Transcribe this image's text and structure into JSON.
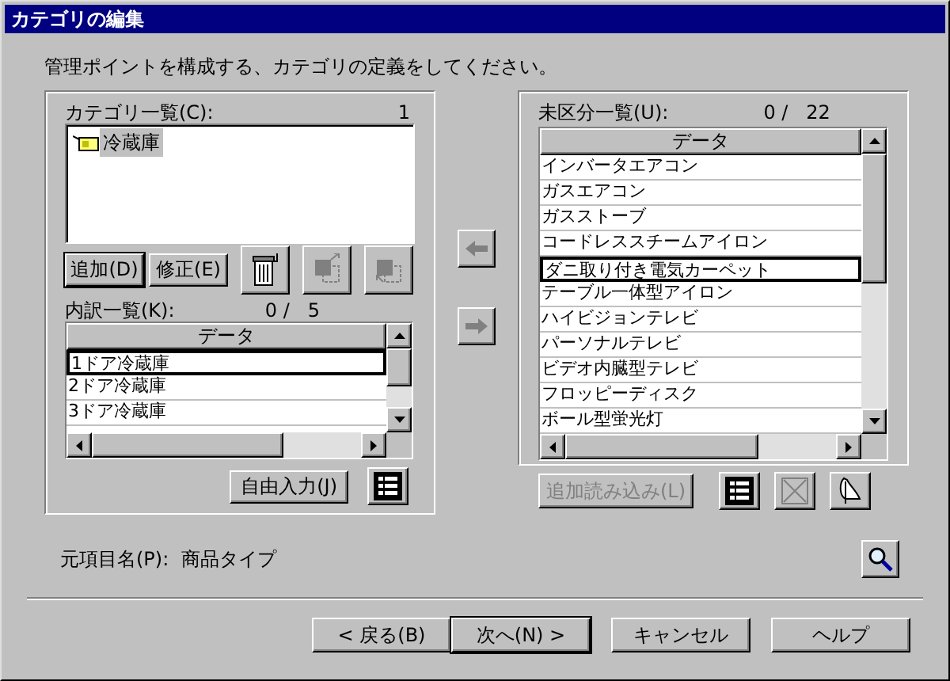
{
  "window": {
    "title": "カテゴリの編集"
  },
  "instruction": "管理ポイントを構成する、カテゴリの定義をしてください。",
  "category_list": {
    "label": "カテゴリ一覧(C):",
    "count": "1",
    "items": [
      {
        "label": "冷蔵庫",
        "selected": true
      }
    ]
  },
  "category_buttons": [
    {
      "label": "追加(D)",
      "disabled": false
    },
    {
      "label": "修正(E)",
      "disabled": false
    }
  ],
  "category_icon_buttons": [
    {
      "disabled": false
    },
    {
      "disabled": true
    },
    {
      "disabled": true
    }
  ],
  "breakdown_list": {
    "label": "内訳一覧(K):",
    "count": "0 /   5",
    "column": "データ",
    "rows": [
      {
        "text": "1ドア冷蔵庫",
        "focused": true
      },
      {
        "text": "2ドア冷蔵庫",
        "focused": false
      },
      {
        "text": "3ドア冷蔵庫",
        "focused": false
      }
    ]
  },
  "breakdown_buttons": {
    "free_input": {
      "label": "自由入力(J)",
      "disabled": false
    },
    "list_button": {
      "disabled": false
    }
  },
  "move_buttons": [
    {
      "disabled": true
    },
    {
      "disabled": true
    }
  ],
  "unclassified_list": {
    "label": "未区分一覧(U):",
    "count": "0 /   22",
    "column": "データ",
    "rows": [
      {
        "text": "インバータエアコン",
        "focused": false
      },
      {
        "text": "ガスエアコン",
        "focused": false
      },
      {
        "text": "ガスストーブ",
        "focused": false
      },
      {
        "text": "コードレススチームアイロン",
        "focused": false
      },
      {
        "text": "ダニ取り付き電気カーペット",
        "focused": true
      },
      {
        "text": "テーブル一体型アイロン",
        "focused": false
      },
      {
        "text": "ハイビジョンテレビ",
        "focused": false
      },
      {
        "text": "パーソナルテレビ",
        "focused": false
      },
      {
        "text": "ビデオ内臓型テレビ",
        "focused": false
      },
      {
        "text": "フロッピーディスク",
        "focused": false
      },
      {
        "text": "ボール型蛍光灯",
        "focused": false
      }
    ]
  },
  "unclassified_buttons": {
    "load_more": {
      "label": "追加読み込み(L)",
      "disabled": true
    },
    "icon_buttons": [
      {
        "disabled": false
      },
      {
        "disabled": true
      },
      {
        "disabled": false
      }
    ]
  },
  "source_item": {
    "label": "元項目名(P):",
    "value": "商品タイプ"
  },
  "footer_buttons": [
    {
      "label": "< 戻る(B)",
      "default": false
    },
    {
      "label": "次へ(N) >",
      "default": true
    },
    {
      "label": "キャンセル",
      "default": false
    },
    {
      "label": "ヘルプ",
      "default": false
    }
  ]
}
